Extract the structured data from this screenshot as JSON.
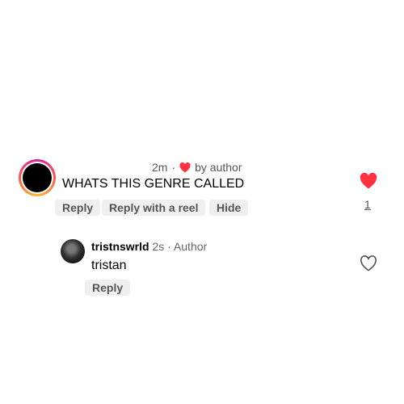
{
  "comment": {
    "time": "2m",
    "liked_by": "by author",
    "text": "WHATS THIS GENRE CALLED",
    "actions": {
      "reply": "Reply",
      "reply_reel": "Reply with a reel",
      "hide": "Hide"
    },
    "like_count": "1",
    "heart_color": "#ff3040"
  },
  "reply": {
    "username": "tristnswrld",
    "info": "2s · Author",
    "text": "tristan",
    "action": "Reply"
  }
}
